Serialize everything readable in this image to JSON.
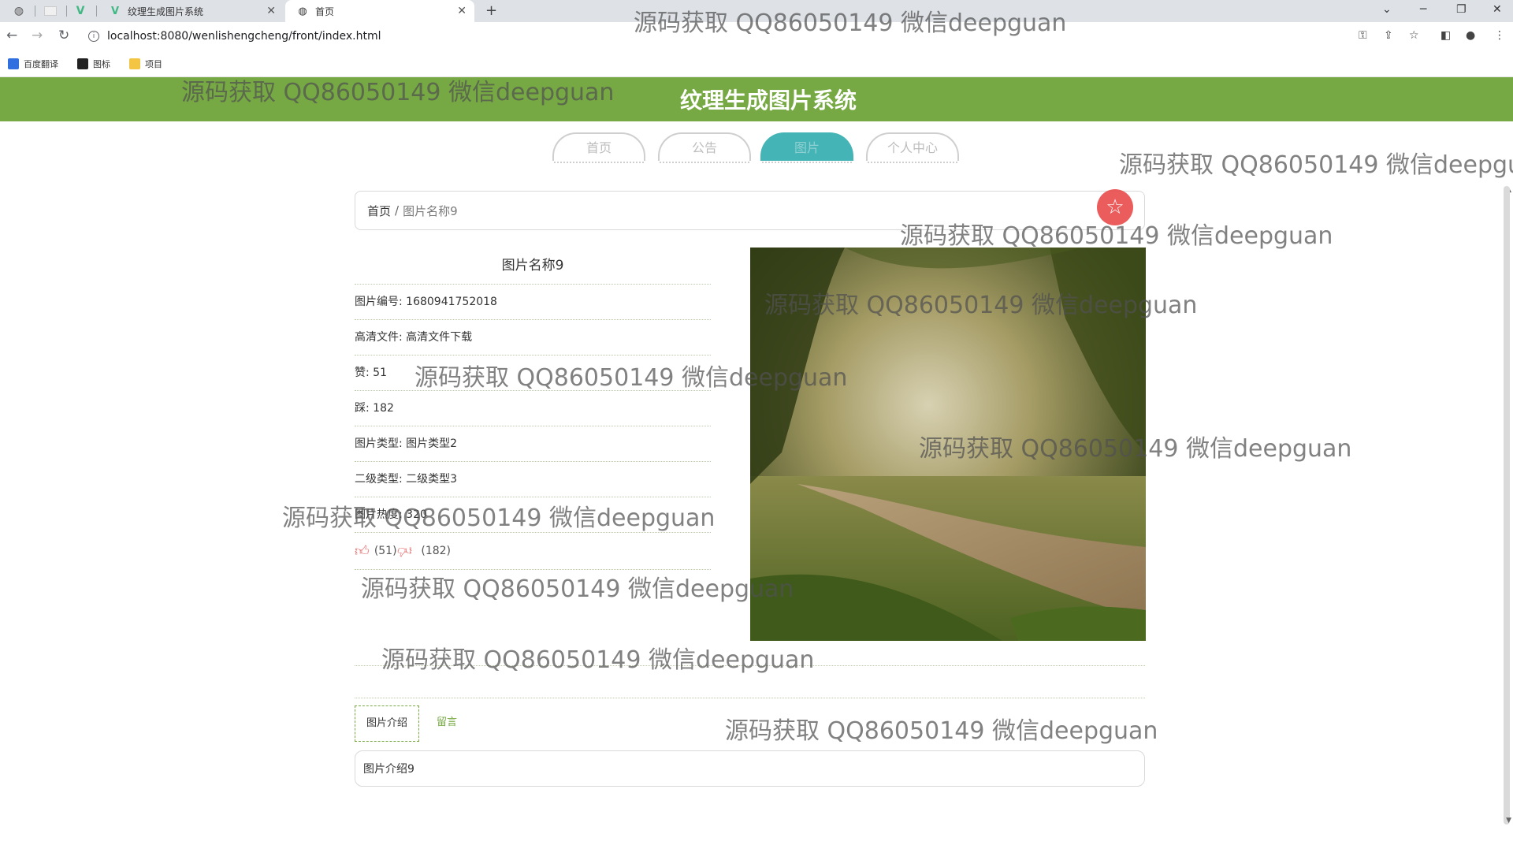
{
  "browser": {
    "tabs": [
      {
        "label": "纹理生成图片系统",
        "active": false
      },
      {
        "label": "首页",
        "active": true
      }
    ],
    "url": "localhost:8080/wenlishengcheng/front/index.html",
    "bookmarks": [
      "百度翻译",
      "图标",
      "项目"
    ]
  },
  "site": {
    "title": "纹理生成图片系统",
    "nav": [
      "首页",
      "公告",
      "图片",
      "个人中心"
    ],
    "active_nav": "图片"
  },
  "breadcrumb": {
    "home": "首页",
    "separator": "/",
    "current": "图片名称9"
  },
  "detail": {
    "title": "图片名称9",
    "fields": [
      "图片编号: 1680941752018",
      "高清文件: 高清文件下载",
      "赞: 51",
      "踩: 182",
      "图片类型: 图片类型2",
      "二级类型: 二级类型3",
      "图片热度: 320"
    ],
    "like_count": "(51)",
    "dislike_count": "(182)"
  },
  "tabs": {
    "intro": "图片介绍",
    "comments": "留言"
  },
  "description": "图片介绍9",
  "watermark": "源码获取 QQ86050149 微信deepguan",
  "colors": {
    "header": "#76a943",
    "active_nav": "#45b4b6",
    "favorite": "#e94b4b"
  }
}
